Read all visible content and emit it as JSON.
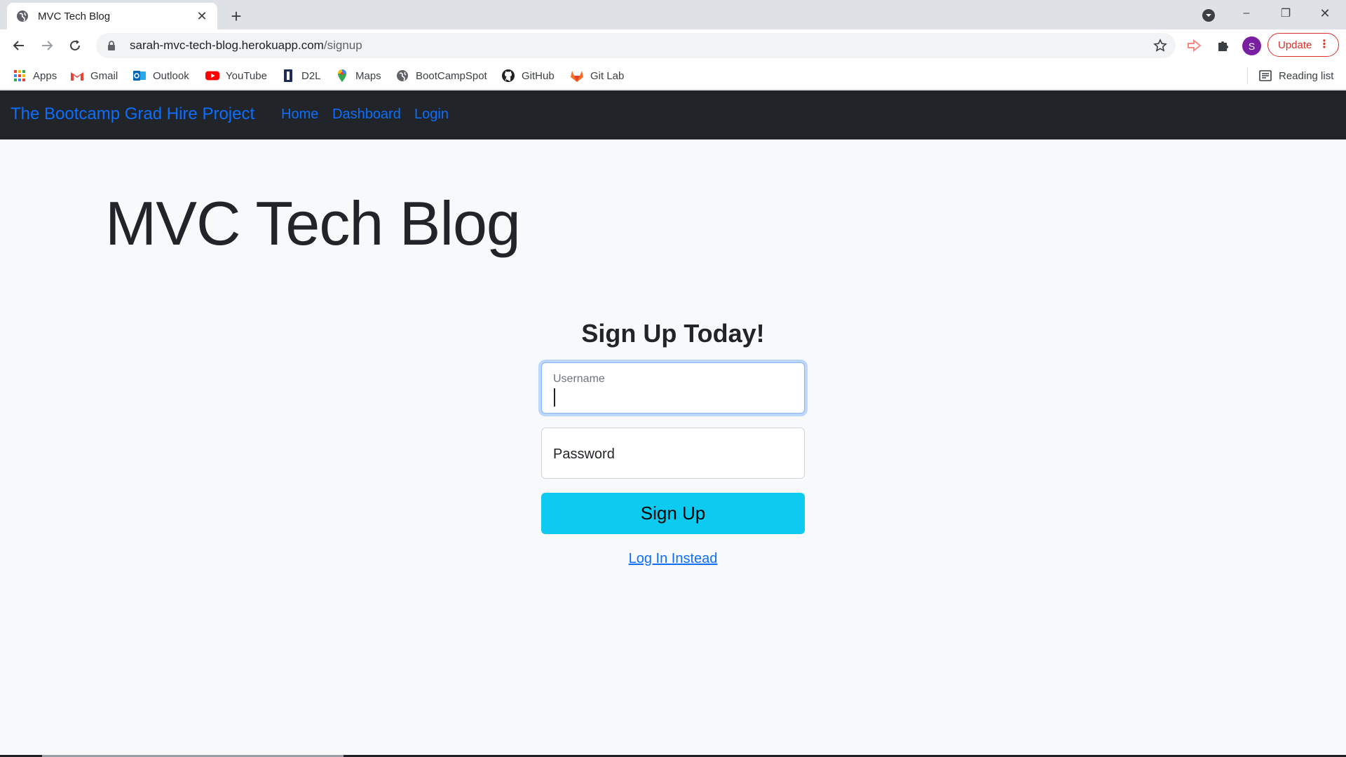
{
  "browser": {
    "tab": {
      "title": "MVC Tech Blog",
      "close_glyph": "✕"
    },
    "new_tab_glyph": "+",
    "window_controls": {
      "minimize": "–",
      "restore": "❐",
      "close": "✕"
    },
    "address_bar": {
      "host": "sarah-mvc-tech-blog.herokuapp.com",
      "path": "/signup"
    },
    "profile_initial": "S",
    "update_label": "Update",
    "update_menu_glyph": "⋮",
    "bookmarks": [
      {
        "label": "Apps",
        "icon": "apps-grid-icon"
      },
      {
        "label": "Gmail",
        "icon": "gmail-icon"
      },
      {
        "label": "Outlook",
        "icon": "outlook-icon"
      },
      {
        "label": "YouTube",
        "icon": "youtube-icon"
      },
      {
        "label": "D2L",
        "icon": "d2l-icon"
      },
      {
        "label": "Maps",
        "icon": "maps-pin-icon"
      },
      {
        "label": "BootCampSpot",
        "icon": "globe-icon"
      },
      {
        "label": "GitHub",
        "icon": "github-icon"
      },
      {
        "label": "Git Lab",
        "icon": "gitlab-icon"
      }
    ],
    "reading_list": "Reading list",
    "colors": {
      "tabstrip": "#dee1e6",
      "update_accent": "#d93025",
      "profile": "#7b1fa2"
    }
  },
  "navbar": {
    "brand": "The Bootcamp Grad Hire Project",
    "links": [
      "Home",
      "Dashboard",
      "Login"
    ],
    "colors": {
      "background": "#212529",
      "link": "#0d6efd"
    }
  },
  "hero": {
    "title": "MVC Tech Blog"
  },
  "signup_form": {
    "heading": "Sign Up Today!",
    "username": {
      "label": "Username",
      "value": ""
    },
    "password": {
      "label": "Password",
      "value": ""
    },
    "submit_label": "Sign Up",
    "alt_link": "Log In Instead",
    "colors": {
      "button": "#0dcaf0",
      "focus_ring": "#86b7fe"
    }
  }
}
